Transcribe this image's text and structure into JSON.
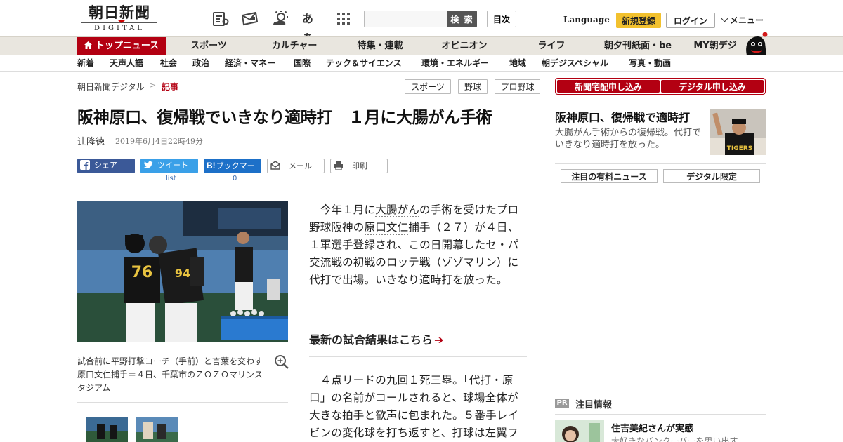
{
  "header": {
    "logo_main": "朝日新聞",
    "logo_sub": "DIGITAL",
    "icons": [
      "newspaper-icon",
      "mail-icon",
      "weather-icon",
      "font-size-icon",
      "grid-icon"
    ],
    "font_size_glyph": "あぁ",
    "search_placeholder": "",
    "search_button": "検 索",
    "toc_button": "目次",
    "language": "Language",
    "register": "新規登録",
    "login": "ログイン",
    "menu": "メニュー"
  },
  "nav_main": [
    "トップニュース",
    "スポーツ",
    "カルチャー",
    "特集・連載",
    "オピニオン",
    "ライフ",
    "朝夕刊紙面・be",
    "MY朝デジ"
  ],
  "nav_sub": [
    "新着",
    "天声人語",
    "社会",
    "政治",
    "経済・マネー",
    "国際",
    "テック＆サイエンス",
    "環境・エネルギー",
    "地域",
    "朝デジスペシャル",
    "写真・動画"
  ],
  "breadcrumb": {
    "home": "朝日新聞デジタル",
    "separator": ">",
    "current": "記事"
  },
  "tags": [
    "スポーツ",
    "野球",
    "プロ野球"
  ],
  "cta": {
    "paper": "新聞宅配申し込み",
    "digital": "デジタル申し込み"
  },
  "article": {
    "headline": "阪神原口、復帰戦でいきなり適時打　１月に大腸がん手術",
    "author": "辻隆徳",
    "date": "2019年6月4日22時49分",
    "share": {
      "facebook": "シェア",
      "twitter": "ツイート",
      "twitter_count": "list",
      "hatena": "ブックマーク",
      "hatena_count": "0",
      "mail": "メール",
      "print": "印刷"
    },
    "caption": "試合前に平野打撃コーチ（手前）と言葉を交わす原口文仁捕手＝４日、千葉市のＺＯＺＯマリンスタジアム",
    "para1_a": "　今年１月に",
    "para1_kw1": "大腸がん",
    "para1_b": "の手術を受けたプロ野球阪神の",
    "para1_kw2": "原口文仁",
    "para1_c": "捕手（２７）が４日、１軍選手登録され、この日開幕したセ・パ交流戦の初戦のロッテ戦（ゾゾマリン）に代打で出場。いきなり適時打を放った。",
    "latest_link": "最新の試合結果はこちら",
    "para2": "　４点リードの九回１死三塁。「代打・原口」の名前がコールされると、球場全体が大きな拍手と歓声に包まれた。５番手レイビンの変化球を打ち返すと、打球は左翼フ"
  },
  "sidebar": {
    "feature_title": "阪神原口、復帰戦で適時打",
    "feature_desc": "大腸がん手術からの復帰戦。代打でいきなり適時打を放った。",
    "tab_paid": "注目の有料ニュース",
    "tab_digital": "デジタル限定",
    "pr_badge": "PR",
    "pr_title": "注目情報",
    "pr_headline": "住吉美紀さんが実感",
    "pr_sub": "大好きなバンクーバーを思い出す"
  },
  "colors": {
    "brand_red": "#b30012",
    "nav_bg": "#e9e6df",
    "register_yellow": "#f2c12e",
    "facebook": "#3b5998",
    "twitter": "#3aa0e8",
    "hatena": "#1d70c8"
  }
}
